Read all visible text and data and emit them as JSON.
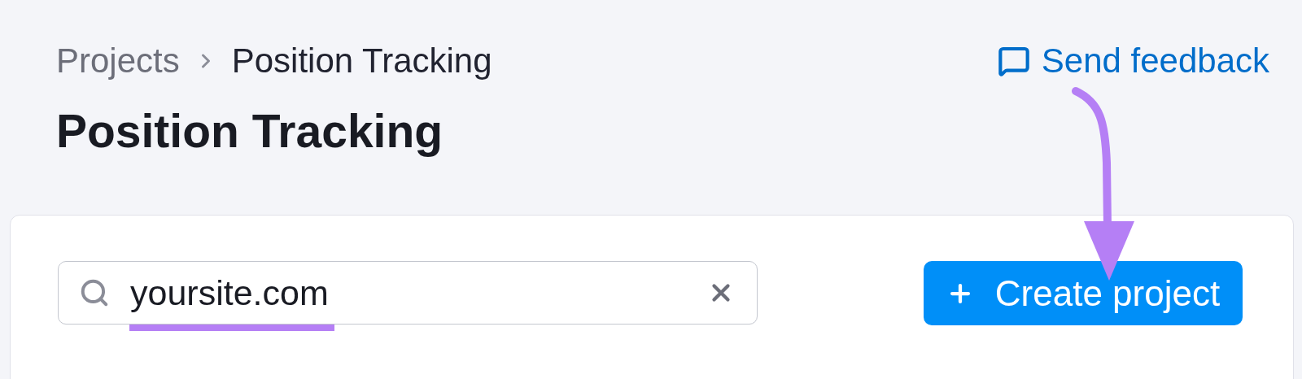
{
  "breadcrumbs": [
    {
      "label": "Projects",
      "current": false
    },
    {
      "label": "Position Tracking",
      "current": true
    }
  ],
  "feedback_link": {
    "label": "Send feedback"
  },
  "page_title": "Position Tracking",
  "search": {
    "value": "yoursite.com"
  },
  "create_button": {
    "label": "Create project"
  }
}
